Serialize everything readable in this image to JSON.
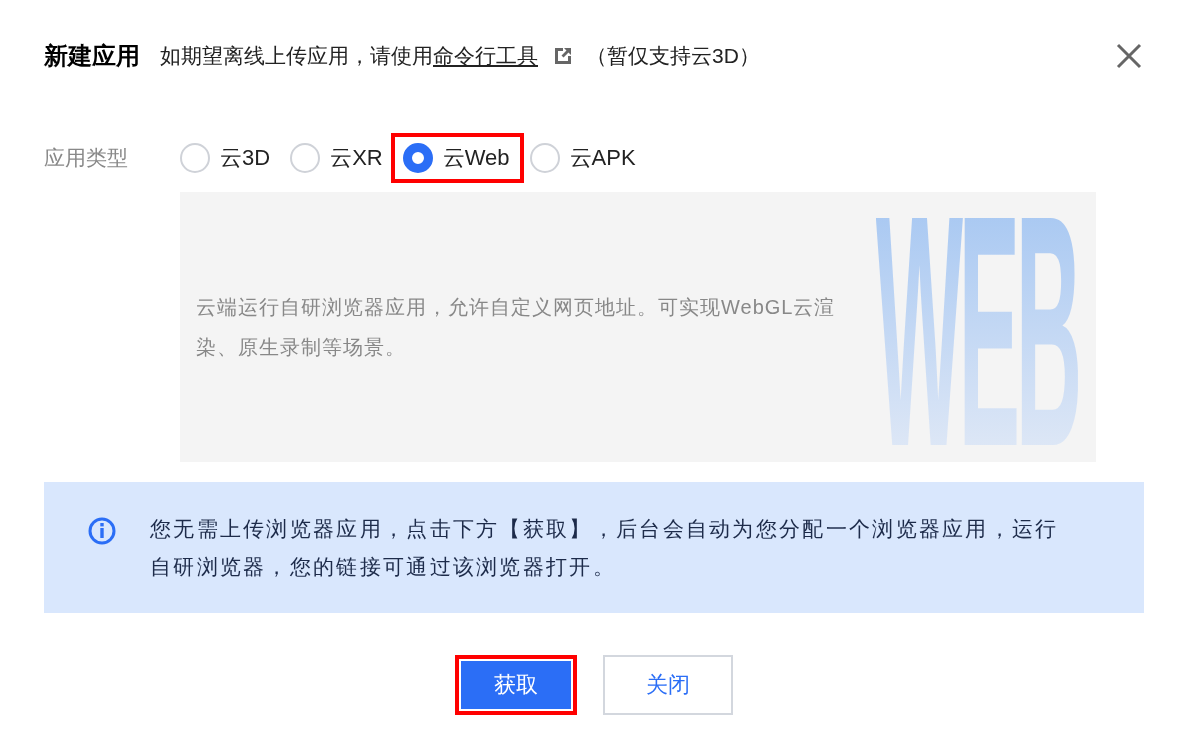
{
  "dialog": {
    "title": "新建应用",
    "subtitle": {
      "before": "如期望离线上传应用，请使用",
      "link": "命令行工具",
      "after": "（暂仅支持云3D）"
    }
  },
  "app_type": {
    "label": "应用类型",
    "options": [
      {
        "label": "云3D",
        "selected": false,
        "highlighted": false
      },
      {
        "label": "云XR",
        "selected": false,
        "highlighted": false
      },
      {
        "label": "云Web",
        "selected": true,
        "highlighted": true
      },
      {
        "label": "云APK",
        "selected": false,
        "highlighted": false
      }
    ]
  },
  "type_card": {
    "graphic_text": "WEB",
    "description": "云端运行自研浏览器应用，允许自定义网页地址。可实现WebGL云渲染、原生录制等场景。"
  },
  "notice": {
    "text": "您无需上传浏览器应用，点击下方【获取】，后台会自动为您分配一个浏览器应用，运行自研浏览器，您的链接可通过该浏览器打开。"
  },
  "buttons": [
    {
      "label": "获取",
      "kind": "primary",
      "highlighted": true
    },
    {
      "label": "关闭",
      "kind": "secondary",
      "highlighted": false
    }
  ]
}
